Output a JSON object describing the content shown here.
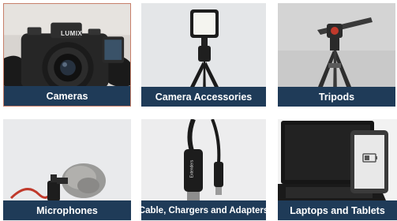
{
  "categories": [
    {
      "label": "Cameras"
    },
    {
      "label": "Camera Accessories"
    },
    {
      "label": "Tripods"
    },
    {
      "label": "Microphones"
    },
    {
      "label": "Cable, Chargers and Adapters"
    },
    {
      "label": "Laptops and Tablets"
    }
  ],
  "brand_text": {
    "camera": "LUMIX",
    "cable": "Extenders"
  },
  "colors": {
    "caption_bg": "#1f3b58",
    "caption_text": "#ffffff",
    "active_border": "#c77f6a"
  },
  "icons": [
    "camera-icon",
    "led-light-icon",
    "tripod-icon",
    "microphone-icon",
    "hdmi-cable-icon",
    "laptop-icon"
  ]
}
